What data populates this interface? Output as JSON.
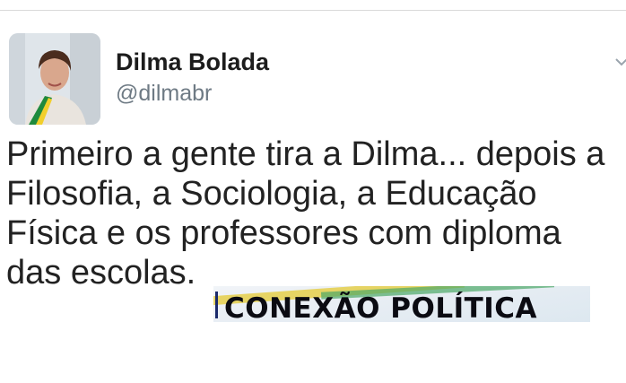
{
  "author": {
    "display_name": "Dilma Bolada",
    "handle": "@dilmabr"
  },
  "tweet": {
    "lines": [
      "Primeiro a gente tira a Dilma... depois a",
      "Filosofia, a Sociologia, a Educação",
      "Física e os professores com diploma",
      "das escolas."
    ]
  },
  "watermark": {
    "text": "CONEXÃO POLÍTICA"
  },
  "icons": {
    "avatar": "profile-photo",
    "menu": "chevron-down-icon"
  },
  "colors": {
    "text": "#222222",
    "handle": "#6e7a84",
    "divider": "#d9d9d9"
  }
}
